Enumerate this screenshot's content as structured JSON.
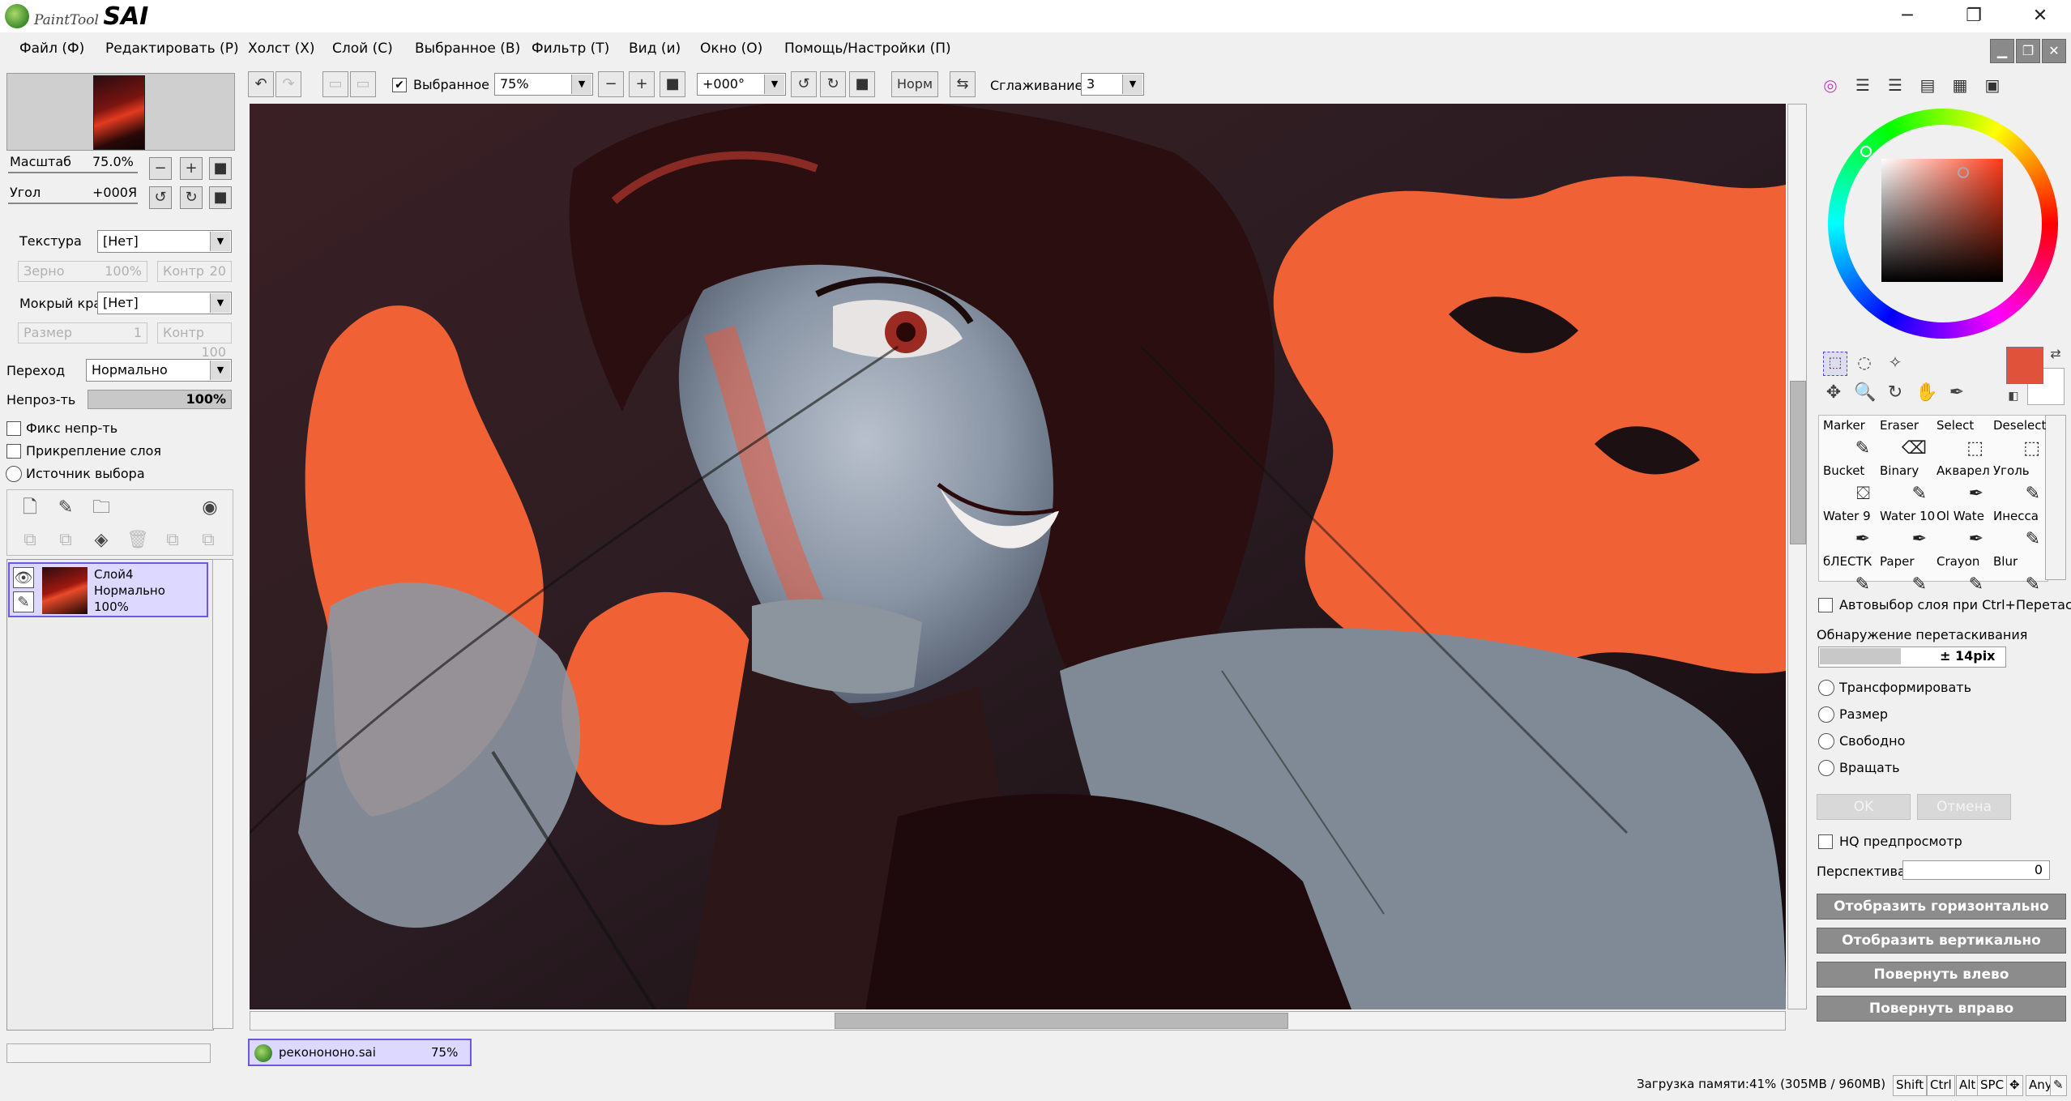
{
  "app": {
    "logo_small": "PaintTool",
    "logo_big": "SAI"
  },
  "window_controls": {
    "minimize": "─",
    "restore": "❐",
    "close": "✕"
  },
  "menu": [
    "Файл (Ф)",
    "Редактировать (Р)",
    "Холст (Х)",
    "Слой (С)",
    "Выбранное (В)",
    "Фильтр (Т)",
    "Вид (и)",
    "Окно (О)",
    "Помощь/Настройки (П)"
  ],
  "navigator": {
    "zoom_label": "Масштаб",
    "zoom_value": "75.0%",
    "angle_label": "Угол",
    "angle_value": "+000Я"
  },
  "brush_settings": {
    "texture_label": "Текстура",
    "texture_value": "[Нет]",
    "grain_label": "Зерно",
    "grain_value": "100%",
    "contrast_label": "Контр",
    "contrast_value": "20",
    "wet_edge_label": "Мокрый край",
    "wet_edge_value": "[Нет]",
    "size_label": "Размер",
    "size_value": "1",
    "contrast2_label": "Контр",
    "contrast2_value": "100"
  },
  "layer_props": {
    "blend_label": "Переход",
    "blend_value": "Нормально",
    "opacity_label": "Непроз-ть",
    "opacity_value": "100%",
    "lock_opacity": "Фикс непр-ть",
    "clip_layer": "Прикрепление слоя",
    "selection_source": "Источник выбора"
  },
  "layers": [
    {
      "name": "Слой4",
      "mode": "Нормально",
      "opacity": "100%"
    }
  ],
  "toolbar": {
    "selection_label": "Выбранное",
    "zoom_value": "75%",
    "angle_value": "+000°",
    "norm_label": "Норм",
    "smoothing_label": "Сглаживание",
    "smoothing_value": "3"
  },
  "document_tab": {
    "name": "реконононо.sai",
    "zoom": "75%"
  },
  "tools": [
    {
      "name": "Marker",
      "icon": "✎"
    },
    {
      "name": "Eraser",
      "icon": "⌫"
    },
    {
      "name": "Select",
      "icon": "⬚"
    },
    {
      "name": "Deselect",
      "icon": "⬚"
    },
    {
      "name": "Bucket",
      "icon": "⛋"
    },
    {
      "name": "Binary",
      "icon": "✎"
    },
    {
      "name": "Акварел",
      "icon": "✒"
    },
    {
      "name": "Уголь",
      "icon": "✎"
    },
    {
      "name": "Water 9",
      "icon": "✒"
    },
    {
      "name": "Water 10",
      "icon": "✒"
    },
    {
      "name": "Ol Wate",
      "icon": "✒"
    },
    {
      "name": "Инесса",
      "icon": "✎"
    },
    {
      "name": "бЛЕСТК",
      "icon": "✎"
    },
    {
      "name": "Paper",
      "icon": "✎"
    },
    {
      "name": "Crayon",
      "icon": "✎"
    },
    {
      "name": "Blur",
      "icon": "✎"
    }
  ],
  "move_options": {
    "auto_select": "Автовыбор слоя при Ctrl+Перетаскив",
    "drag_detect_label": "Обнаружение перетаскивания",
    "drag_detect_value": "± 14pix",
    "transform": "Трансформировать",
    "scale": "Размер",
    "free": "Свободно",
    "rotate": "Вращать",
    "ok": "OK",
    "cancel": "Отмена",
    "hq_preview": "HQ предпросмотр",
    "perspective_label": "Перспектива",
    "perspective_value": "0",
    "flip_h": "Отобразить горизонтально",
    "flip_v": "Отобразить вертикально",
    "rotate_left": "Повернуть влево",
    "rotate_right": "Повернуть вправо"
  },
  "colors": {
    "primary": "#e0523a",
    "secondary": "#ffffff",
    "accent": "#6b58e8"
  },
  "status": {
    "memory": "Загрузка памяти:41% (305MB / 960MB)",
    "keys": [
      "Shift",
      "Ctrl",
      "Alt",
      "SPC",
      "✥",
      "Any",
      "✎"
    ]
  }
}
